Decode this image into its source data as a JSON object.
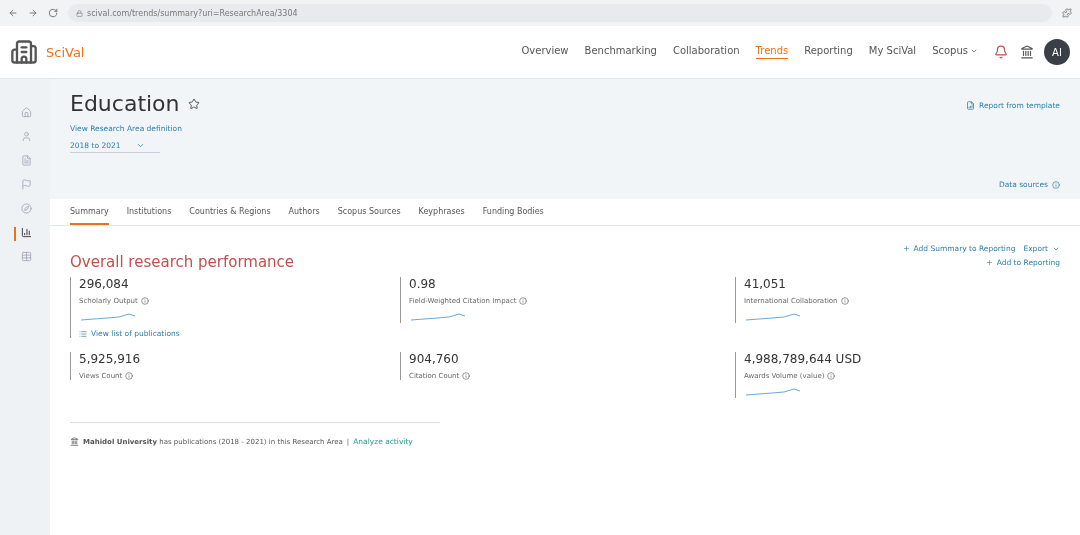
{
  "browser": {
    "url": "scival.com/trends/summary?uri=ResearchArea/3304"
  },
  "brand": {
    "name": "SciVal"
  },
  "nav": [
    {
      "label": "Overview",
      "selected": false
    },
    {
      "label": "Benchmarking",
      "selected": false
    },
    {
      "label": "Collaboration",
      "selected": false
    },
    {
      "label": "Trends",
      "selected": true
    },
    {
      "label": "Reporting",
      "selected": false
    },
    {
      "label": "My SciVal",
      "selected": false
    },
    {
      "label": "Scopus",
      "selected": false,
      "dropdown": true
    }
  ],
  "user": {
    "initials": "AI"
  },
  "sidebar": [
    {
      "selected": false
    },
    {
      "selected": false
    },
    {
      "selected": false
    },
    {
      "selected": false
    },
    {
      "selected": false
    },
    {
      "selected": true
    },
    {
      "selected": false
    }
  ],
  "page": {
    "title": "Education",
    "definition_link": "View Research Area definition",
    "period": "2018 to 2021",
    "report_link": "Report from template",
    "data_sources": "Data sources"
  },
  "tabs": [
    {
      "label": "Summary",
      "selected": true
    },
    {
      "label": "Institutions",
      "selected": false
    },
    {
      "label": "Countries & Regions",
      "selected": false
    },
    {
      "label": "Authors",
      "selected": false
    },
    {
      "label": "Scopus Sources",
      "selected": false
    },
    {
      "label": "Keyphrases",
      "selected": false
    },
    {
      "label": "Funding Bodies",
      "selected": false
    }
  ],
  "section": {
    "title": "Overall research performance",
    "add_summary": "Add Summary to Reporting",
    "export": "Export",
    "add_reporting": "Add to Reporting"
  },
  "metrics": [
    {
      "value": "296,084",
      "label": "Scholarly Output",
      "sparkline": true,
      "link": "View list of publications"
    },
    {
      "value": "0.98",
      "label": "Field-Weighted Citation Impact",
      "sparkline": true
    },
    {
      "value": "41,051",
      "label": "International Collaboration",
      "sparkline": true
    },
    {
      "value": "5,925,916",
      "label": "Views Count",
      "sparkline": false
    },
    {
      "value": "904,760",
      "label": "Citation Count",
      "sparkline": false
    },
    {
      "value": "4,988,789,644 USD",
      "label": "Awards Volume (value)",
      "sparkline": true
    }
  ],
  "footer": {
    "text": "**Mahidol University** has publications (2018 - 2021) in this Research Area",
    "separator": "|",
    "link": "Analyze activity"
  }
}
